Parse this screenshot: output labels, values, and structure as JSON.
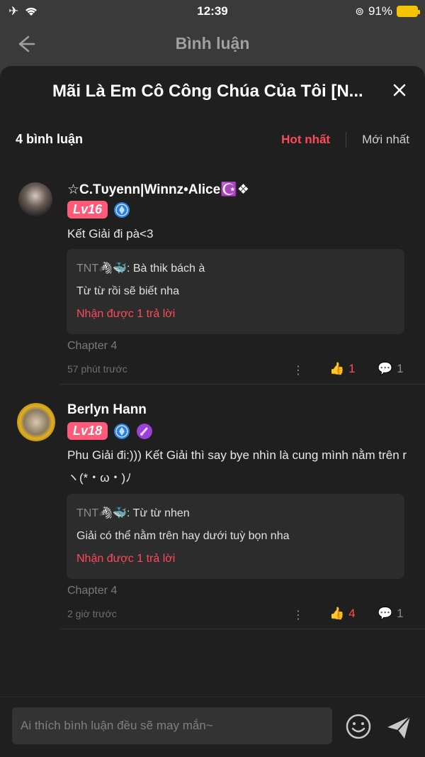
{
  "status_bar": {
    "time": "12:39",
    "battery": "91%"
  },
  "nav": {
    "title": "Bình luận"
  },
  "sheet": {
    "title": "Mãi Là Em Cô Công Chúa Của Tôi [N..."
  },
  "comments_header": {
    "count": "4 bình luận",
    "sort_hot": "Hot nhất",
    "sort_new": "Mới nhất"
  },
  "comments": [
    {
      "name": "☆C.Tυyenn|Winnz•Alice☪️❖",
      "level": "Lv16",
      "text": "Kết Giải đi pà<3",
      "reply": {
        "author": "TNT🦓🐳",
        "text_after_author": ": Bà thik bách à",
        "line2": "Từ từ rồi sẽ biết nha",
        "more": "Nhận được 1 trả lời"
      },
      "chapter": "Chapter 4",
      "time": "57 phút trước",
      "likes": "1",
      "replies": "1"
    },
    {
      "name": "Berlyn Hann",
      "level": "Lv18",
      "text": "Phu Giải đi:))) Kết Giải thì say bye nhìn là cung mình nằm trên r ヽ(*・ω・)ﾉ",
      "reply": {
        "author": "TNT🦓🐳",
        "text_after_author": ": Từ từ nhen",
        "line2": "Giải có thể nằm trên hay dưới tuỳ bọn nha",
        "more": "Nhận được 1 trả lời"
      },
      "chapter": "Chapter 4",
      "time": "2 giờ trước",
      "likes": "4",
      "replies": "1"
    }
  ],
  "input": {
    "placeholder": "Ai thích bình luận đều sẽ may mắn~"
  },
  "colors": {
    "accent": "#ff4a5a",
    "level_badge": "#ff5a78",
    "sheet_bg": "#1f1f1f"
  }
}
